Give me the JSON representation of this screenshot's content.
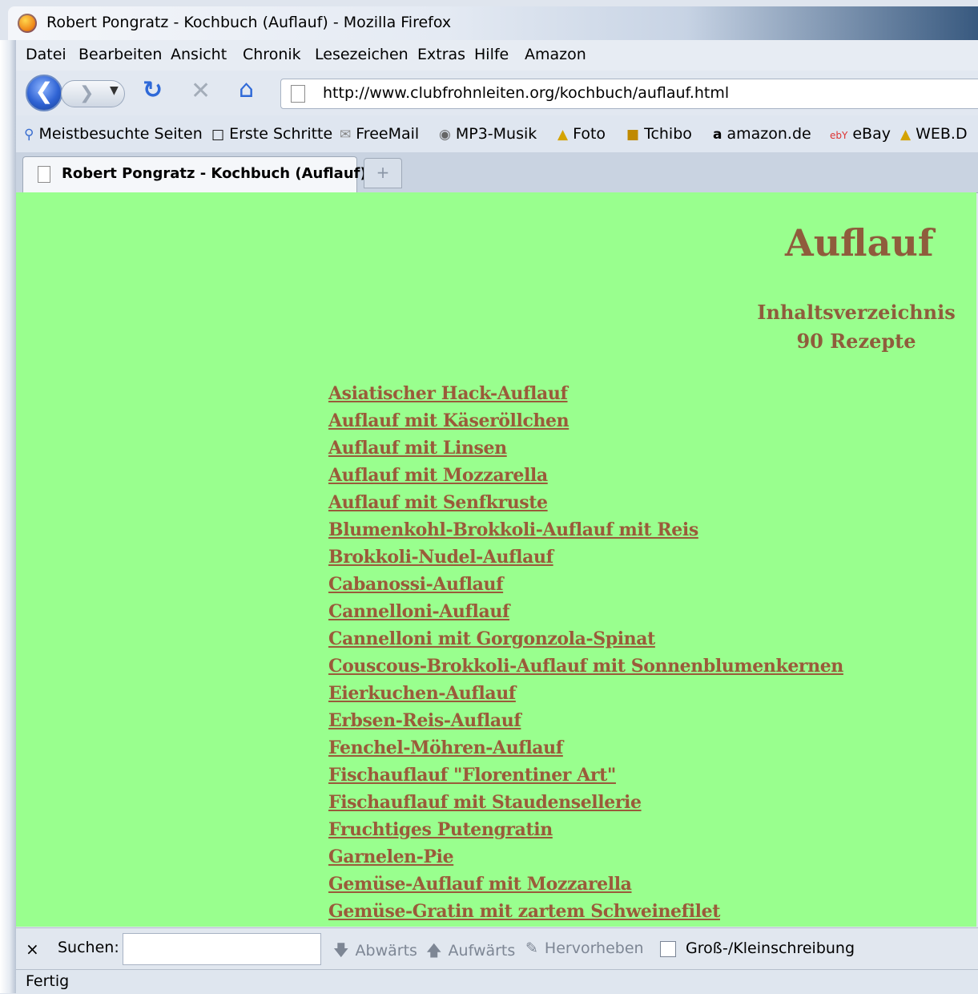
{
  "window": {
    "title": "Robert Pongratz - Kochbuch (Auflauf) - Mozilla Firefox"
  },
  "menu": [
    "Datei",
    "Bearbeiten",
    "Ansicht",
    "Chronik",
    "Lesezeichen",
    "Extras",
    "Hilfe",
    "Amazon"
  ],
  "nav": {
    "url": "http://www.clubfrohnleiten.org/kochbuch/auflauf.html",
    "back_icon": "back-arrow-icon",
    "forward_icon": "forward-arrow-icon",
    "reload_icon": "reload-icon",
    "stop_icon": "stop-icon",
    "home_icon": "home-icon"
  },
  "bookmarks": [
    "Meistbesuchte Seiten",
    "Erste Schritte",
    "FreeMail",
    "MP3-Musik",
    "Foto",
    "Tchibo",
    "amazon.de",
    "eBay",
    "WEB.D"
  ],
  "tab": {
    "title": "Robert Pongratz - Kochbuch (Auflauf)",
    "new_tab_symbol": "+"
  },
  "page": {
    "heading": "Auflauf",
    "subheading": "Inhaltsverzeichnis",
    "count": "90 Rezepte",
    "bg_color": "#99ff8e",
    "link_color": "#9a5b3a",
    "recipes": [
      "Asiatischer Hack-Auflauf",
      "Auflauf mit Käseröllchen",
      "Auflauf mit Linsen",
      "Auflauf mit Mozzarella",
      "Auflauf mit Senfkruste",
      "Blumenkohl-Brokkoli-Auflauf mit Reis",
      "Brokkoli-Nudel-Auflauf",
      "Cabanossi-Auflauf",
      "Cannelloni-Auflauf",
      "Cannelloni mit Gorgonzola-Spinat",
      "Couscous-Brokkoli-Auflauf mit Sonnenblumenkernen",
      "Eierkuchen-Auflauf",
      "Erbsen-Reis-Auflauf",
      "Fenchel-Möhren-Auflauf",
      "Fischauflauf \"Florentiner Art\"",
      "Fischauflauf mit Staudensellerie",
      "Fruchtiges Putengratin",
      "Garnelen-Pie",
      "Gemüse-Auflauf mit Mozzarella",
      "Gemüse-Gratin mit zartem Schweinefilet"
    ]
  },
  "findbar": {
    "close": "×",
    "label": "Suchen:",
    "search_value": "",
    "down": "Abwärts",
    "up": "Aufwärts",
    "highlight": "Hervorheben",
    "match_case": "Groß-/Kleinschreibung"
  },
  "status": "Fertig"
}
